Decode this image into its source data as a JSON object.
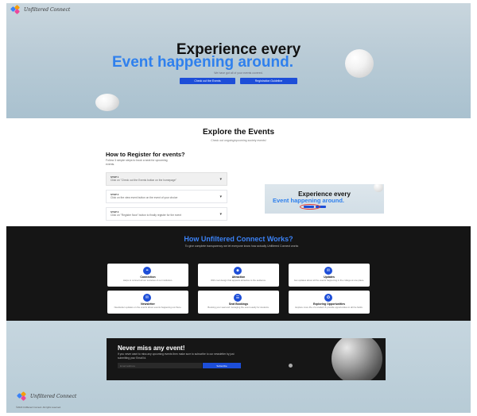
{
  "brand": {
    "name": "Unfiltered Connect"
  },
  "colors": {
    "accent": "#2f80ed",
    "button": "#1d4ed8",
    "dark_section": "#151515"
  },
  "hero": {
    "title_line1": "Experience every",
    "title_line2": "Event happening around.",
    "subtitle": "We have got all of your events covered.",
    "button_events": "Check out the Events",
    "button_register": "Registration Guideline"
  },
  "explore": {
    "title": "Explore the Events",
    "subtitle": "Check out ongoing/upcoming society events!",
    "register_title": "How to Register for events?",
    "register_desc": "Follow 3 simple steps to book a seat for upcoming events.",
    "steps": [
      {
        "label": "STEP 1",
        "text": "Click on \"Check out the Events button on the homepage\"",
        "icon": "chevron-down-icon"
      },
      {
        "label": "STEP 2",
        "text": "Click on the view event button on the event of your choice",
        "icon": "chevron-down-icon"
      },
      {
        "label": "STEP 3",
        "text": "Click on \"Register Now\" button to finally register for the event",
        "icon": "chevron-down-icon"
      }
    ],
    "preview": {
      "title_line1": "Experience every",
      "title_line2": "Event happening around."
    }
  },
  "how": {
    "title": "How Unfiltered Connect Works?",
    "subtitle": "To give complete transparency we let everyone know how actually Unfiltered Connect works",
    "cards": [
      {
        "title": "Connection",
        "desc": "Helps to connect all our societies of our institution.",
        "icon": "link-icon",
        "glyph": "⚭"
      },
      {
        "title": "Attraction",
        "desc": "With cool design that appears attractive to the audience.",
        "icon": "users-icon",
        "glyph": "☻"
      },
      {
        "title": "Updates",
        "desc": "Get updates about all the events happening in the college at one place.",
        "icon": "bell-icon",
        "glyph": "✉"
      },
      {
        "title": "Newsletter",
        "desc": "Newsletter updates on the events about events happening out there.",
        "icon": "mail-icon",
        "glyph": "✉"
      },
      {
        "title": "Seat Bookings",
        "desc": "Booking your seat and managing the event easily for students.",
        "icon": "ticket-icon",
        "glyph": "☰"
      },
      {
        "title": "Exploring Opportunities",
        "desc": "Explore more life of a student & provide opportunities in all the fields.",
        "icon": "compass-icon",
        "glyph": "✪"
      }
    ]
  },
  "newsletter": {
    "title": "Never miss any event!",
    "text": "If you never want to miss any upcoming events then make sure to subscribe to our newsletter by just submitting your Email Id.",
    "input_placeholder": "Email address",
    "button": "Subscribe"
  },
  "footer": {
    "brand": "Unfiltered Connect",
    "copyright": "©2023 Unfiltered Connect. All rights reserved."
  }
}
